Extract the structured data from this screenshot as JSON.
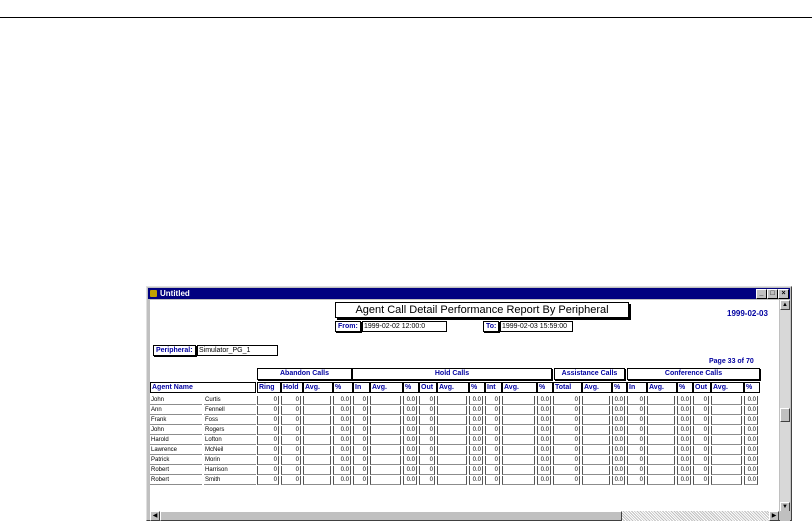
{
  "window": {
    "title": "Untitled",
    "buttons": {
      "minimize": "_",
      "maximize": "□",
      "close": "×"
    }
  },
  "report": {
    "title": "Agent Call Detail Performance Report By Peripheral",
    "date": "1999-02-03",
    "from_label": "From:",
    "from_value": "1999-02-02 12:00:0",
    "to_label": "To:",
    "to_value": "1999-02-03 15:59:00",
    "peripheral_label": "Peripheral:",
    "peripheral_value": "Simulator_PG_1",
    "page": "Page 33 of 70"
  },
  "groups": [
    "Abandon Calls",
    "Hold Calls",
    "Assistance Calls",
    "Conference Calls"
  ],
  "columns": [
    "Agent Name",
    "Ring",
    "Hold",
    "Avg.",
    "%",
    "In",
    "Avg.",
    "%",
    "Out",
    "Avg.",
    "%",
    "Int",
    "Avg.",
    "%",
    "Total",
    "Avg.",
    "%",
    "In",
    "Avg.",
    "%",
    "Out",
    "Avg.",
    "%"
  ],
  "rows": [
    [
      "John",
      "Curtis",
      "0",
      "0",
      "",
      "0.0",
      "0",
      "",
      "0.0",
      "0",
      "",
      "0.0",
      "0",
      "",
      "0.0",
      "0",
      "",
      "0.0",
      "0",
      "",
      "0.0",
      "0",
      "",
      "0.0"
    ],
    [
      "Ann",
      "Fennell",
      "0",
      "0",
      "",
      "0.0",
      "0",
      "",
      "0.0",
      "0",
      "",
      "0.0",
      "0",
      "",
      "0.0",
      "0",
      "",
      "0.0",
      "0",
      "",
      "0.0",
      "0",
      "",
      "0.0"
    ],
    [
      "Frank",
      "Foss",
      "0",
      "0",
      "",
      "0.0",
      "0",
      "",
      "0.0",
      "0",
      "",
      "0.0",
      "0",
      "",
      "0.0",
      "0",
      "",
      "0.0",
      "0",
      "",
      "0.0",
      "0",
      "",
      "0.0"
    ],
    [
      "John",
      "Rogers",
      "0",
      "0",
      "",
      "0.0",
      "0",
      "",
      "0.0",
      "0",
      "",
      "0.0",
      "0",
      "",
      "0.0",
      "0",
      "",
      "0.0",
      "0",
      "",
      "0.0",
      "0",
      "",
      "0.0"
    ],
    [
      "Harold",
      "Lofton",
      "0",
      "0",
      "",
      "0.0",
      "0",
      "",
      "0.0",
      "0",
      "",
      "0.0",
      "0",
      "",
      "0.0",
      "0",
      "",
      "0.0",
      "0",
      "",
      "0.0",
      "0",
      "",
      "0.0"
    ],
    [
      "Lawrence",
      "McNeil",
      "0",
      "0",
      "",
      "0.0",
      "0",
      "",
      "0.0",
      "0",
      "",
      "0.0",
      "0",
      "",
      "0.0",
      "0",
      "",
      "0.0",
      "0",
      "",
      "0.0",
      "0",
      "",
      "0.0"
    ],
    [
      "Patrick",
      "Morin",
      "0",
      "0",
      "",
      "0.0",
      "0",
      "",
      "0.0",
      "0",
      "",
      "0.0",
      "0",
      "",
      "0.0",
      "0",
      "",
      "0.0",
      "0",
      "",
      "0.0",
      "0",
      "",
      "0.0"
    ],
    [
      "Robert",
      "Harrison",
      "0",
      "0",
      "",
      "0.0",
      "0",
      "",
      "0.0",
      "0",
      "",
      "0.0",
      "0",
      "",
      "0.0",
      "0",
      "",
      "0.0",
      "0",
      "",
      "0.0",
      "0",
      "",
      "0.0"
    ],
    [
      "Robert",
      "Smith",
      "0",
      "0",
      "",
      "0.0",
      "0",
      "",
      "0.0",
      "0",
      "",
      "0.0",
      "0",
      "",
      "0.0",
      "0",
      "",
      "0.0",
      "0",
      "",
      "0.0",
      "0",
      "",
      "0.0"
    ]
  ],
  "colors": {
    "title_bar": "#000080",
    "label_blue": "#0000a0",
    "window_gray": "#c0c0c0"
  },
  "icons": {
    "window": "app-icon",
    "scroll_up": "scroll-up-icon",
    "scroll_down": "scroll-down-icon",
    "scroll_left": "scroll-left-icon",
    "scroll_right": "scroll-right-icon"
  }
}
